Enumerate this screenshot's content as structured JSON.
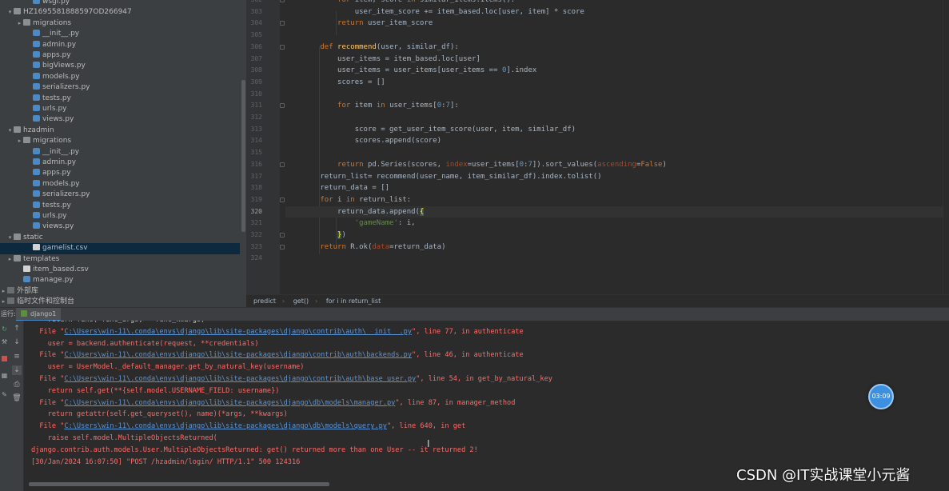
{
  "project_tree": {
    "items": [
      {
        "label": "wsgi.py",
        "type": "py",
        "depth": 2,
        "arrow": ""
      },
      {
        "label": "HZ1695581888597OD266947",
        "type": "folder",
        "depth": 0,
        "arrow": "▾"
      },
      {
        "label": "migrations",
        "type": "folder",
        "depth": 1,
        "arrow": "▸"
      },
      {
        "label": "__init__.py",
        "type": "py",
        "depth": 2,
        "arrow": ""
      },
      {
        "label": "admin.py",
        "type": "py",
        "depth": 2,
        "arrow": ""
      },
      {
        "label": "apps.py",
        "type": "py",
        "depth": 2,
        "arrow": ""
      },
      {
        "label": "bigViews.py",
        "type": "py",
        "depth": 2,
        "arrow": ""
      },
      {
        "label": "models.py",
        "type": "py",
        "depth": 2,
        "arrow": ""
      },
      {
        "label": "serializers.py",
        "type": "py",
        "depth": 2,
        "arrow": ""
      },
      {
        "label": "tests.py",
        "type": "py",
        "depth": 2,
        "arrow": ""
      },
      {
        "label": "urls.py",
        "type": "py",
        "depth": 2,
        "arrow": ""
      },
      {
        "label": "views.py",
        "type": "py",
        "depth": 2,
        "arrow": ""
      },
      {
        "label": "hzadmin",
        "type": "folder",
        "depth": 0,
        "arrow": "▾"
      },
      {
        "label": "migrations",
        "type": "folder",
        "depth": 1,
        "arrow": "▸"
      },
      {
        "label": "__init__.py",
        "type": "py",
        "depth": 2,
        "arrow": ""
      },
      {
        "label": "admin.py",
        "type": "py",
        "depth": 2,
        "arrow": ""
      },
      {
        "label": "apps.py",
        "type": "py",
        "depth": 2,
        "arrow": ""
      },
      {
        "label": "models.py",
        "type": "py",
        "depth": 2,
        "arrow": ""
      },
      {
        "label": "serializers.py",
        "type": "py",
        "depth": 2,
        "arrow": ""
      },
      {
        "label": "tests.py",
        "type": "py",
        "depth": 2,
        "arrow": ""
      },
      {
        "label": "urls.py",
        "type": "py",
        "depth": 2,
        "arrow": ""
      },
      {
        "label": "views.py",
        "type": "py",
        "depth": 2,
        "arrow": ""
      },
      {
        "label": "static",
        "type": "folder",
        "depth": 0,
        "arrow": "▾"
      },
      {
        "label": "gamelist.csv",
        "type": "csv",
        "depth": 2,
        "arrow": "",
        "selected": true
      },
      {
        "label": "templates",
        "type": "folder",
        "depth": 0,
        "arrow": "▸"
      },
      {
        "label": "item_based.csv",
        "type": "csv",
        "depth": 1,
        "arrow": ""
      },
      {
        "label": "manage.py",
        "type": "py",
        "depth": 1,
        "arrow": ""
      },
      {
        "label": "外部库",
        "type": "lib",
        "depth": -1,
        "arrow": "▸"
      },
      {
        "label": "临时文件和控制台",
        "type": "lib",
        "depth": -1,
        "arrow": "▸"
      }
    ]
  },
  "editor": {
    "current_line": "320",
    "lines": [
      {
        "n": "302",
        "html": "            <span class=\"kw\">for</span> item, score <span class=\"kw\">in</span> similar_items.items():"
      },
      {
        "n": "303",
        "html": "                user_item_score += item_based.loc[user, item] * score"
      },
      {
        "n": "304",
        "html": "            <span class=\"kw\">return</span> user_item_score"
      },
      {
        "n": "305",
        "html": ""
      },
      {
        "n": "306",
        "html": "        <span class=\"kw\">def</span> <span class=\"fn\">recommend</span>(user, similar_df):"
      },
      {
        "n": "307",
        "html": "            user_items = item_based.loc[user]"
      },
      {
        "n": "308",
        "html": "            user_items = user_items[user_items == <span class=\"num\">0</span>].index"
      },
      {
        "n": "309",
        "html": "            scores = []"
      },
      {
        "n": "310",
        "html": ""
      },
      {
        "n": "311",
        "html": "            <span class=\"kw\">for</span> item <span class=\"kw\">in</span> user_items[<span class=\"num\">0</span>:<span class=\"num\">7</span>]:"
      },
      {
        "n": "312",
        "html": ""
      },
      {
        "n": "313",
        "html": "                score = get_user_item_score(user, item, similar_df)"
      },
      {
        "n": "314",
        "html": "                scores.append(score)"
      },
      {
        "n": "315",
        "html": ""
      },
      {
        "n": "316",
        "html": "            <span class=\"kw\">return</span> pd.Series(scores, <span class=\"param\">index</span>=user_items[<span class=\"num\">0</span>:<span class=\"num\">7</span>]).sort_values(<span class=\"param\">ascending</span>=<span class=\"kw\">False</span>)"
      },
      {
        "n": "317",
        "html": "        return_list= recommend(user_name, item_similar_df).index.tolist()"
      },
      {
        "n": "318",
        "html": "        return_data = []"
      },
      {
        "n": "319",
        "html": "        <span class=\"kw\">for</span> i <span class=\"kw\">in</span> return_list:"
      },
      {
        "n": "320",
        "html": "            return_data.append(<span class=\"hl\">{</span>"
      },
      {
        "n": "321",
        "html": "                <span class=\"str\">'gameName'</span>: i,"
      },
      {
        "n": "322",
        "html": "            <span class=\"hl\">}</span>)"
      },
      {
        "n": "323",
        "html": "        <span class=\"kw\">return</span> R.ok(<span class=\"param\">data</span>=return_data)"
      },
      {
        "n": "324",
        "html": ""
      }
    ]
  },
  "breadcrumb": {
    "items": [
      "predict",
      "get()",
      "for i in return_list"
    ]
  },
  "run_panel": {
    "label": "运行:",
    "tab_label": "django1"
  },
  "console": {
    "lines": [
      {
        "kind": "plain",
        "html": "    return func(*func_args, **func_kwargs)"
      },
      {
        "kind": "err",
        "html": "  File \"<a>C:\\Users\\win-11\\.conda\\envs\\django\\lib\\site-packages\\django\\contrib\\auth\\__init__.py</a>\", line 77, in authenticate"
      },
      {
        "kind": "err",
        "html": "    user = backend.authenticate(request, **credentials)"
      },
      {
        "kind": "err",
        "html": "  File \"<a>C:\\Users\\win-11\\.conda\\envs\\django\\lib\\site-packages\\django\\contrib\\auth\\backends.py</a>\", line 46, in authenticate"
      },
      {
        "kind": "err",
        "html": "    user = UserModel._default_manager.get_by_natural_key(username)"
      },
      {
        "kind": "err",
        "html": "  File \"<a>C:\\Users\\win-11\\.conda\\envs\\django\\lib\\site-packages\\django\\contrib\\auth\\base_user.py</a>\", line 54, in get_by_natural_key"
      },
      {
        "kind": "err",
        "html": "    return self.get(**{self.model.USERNAME_FIELD: username})"
      },
      {
        "kind": "err",
        "html": "  File \"<a>C:\\Users\\win-11\\.conda\\envs\\django\\lib\\site-packages\\django\\db\\models\\manager.py</a>\", line 87, in manager_method"
      },
      {
        "kind": "err",
        "html": "    return getattr(self.get_queryset(), name)(*args, **kwargs)"
      },
      {
        "kind": "err",
        "html": "  File \"<a>C:\\Users\\win-11\\.conda\\envs\\django\\lib\\site-packages\\django\\db\\models\\query.py</a>\", line 640, in get"
      },
      {
        "kind": "err",
        "html": "    raise self.model.MultipleObjectsReturned("
      },
      {
        "kind": "err",
        "html": "django.contrib.auth.models.User.MultipleObjectsReturned: get() returned more than one User -- it returned 2!"
      },
      {
        "kind": "err",
        "html": "[30/Jan/2024 16:07:50] \"POST /hzadmin/login/ HTTP/1.1\" 500 124316"
      }
    ]
  },
  "timer": "03:09",
  "watermark": "CSDN @IT实战课堂小元酱",
  "colors": {
    "accent": "#4a88c7",
    "error_text": "#ff6b68",
    "link": "#5c95d6",
    "keyword": "#cc7832"
  }
}
